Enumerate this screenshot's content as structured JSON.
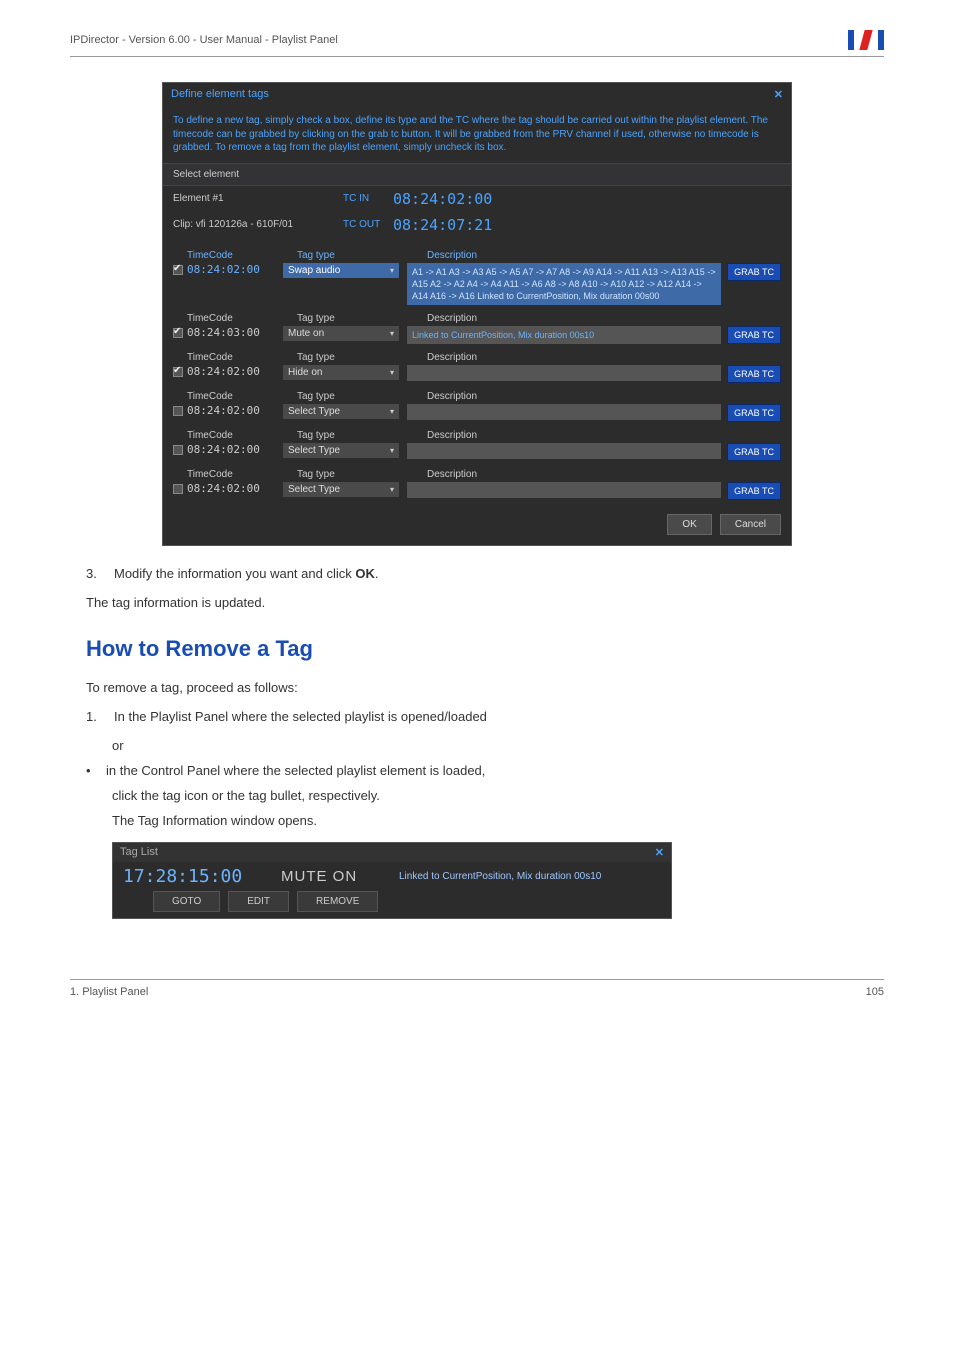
{
  "doc_header": "IPDirector - Version 6.00 - User Manual - Playlist Panel",
  "dialog": {
    "title": "Define element tags",
    "close": "✕",
    "intro": "To define a new tag, simply check a box, define its type and the TC where the tag should be carried out within the playlist element. The timecode can be grabbed by clicking on the grab tc button. It will be grabbed from the PRV channel if used, otherwise no timecode is grabbed. To remove a tag from the playlist element, simply uncheck its box.",
    "select_element": "Select element",
    "element_label": "Element #1",
    "clip_label": "Clip: vfi 120126a - 610F/01",
    "tcin_label": "TC IN",
    "tcout_label": "TC OUT",
    "tcin_val": "08:24:02:00",
    "tcout_val": "08:24:07:21",
    "col_tc": "TimeCode",
    "col_type": "Tag type",
    "col_desc": "Description",
    "grab": "GRAB TC",
    "rows": [
      {
        "checked": true,
        "highlight": true,
        "tc": "08:24:02:00",
        "type": "Swap audio",
        "desc": "A1 -> A1  A3 -> A3  A5 -> A5  A7 -> A7  A8 -> A9  A14 -> A11  A13 -> A13  A15 -> A15  A2 -> A2  A4 -> A4  A11 -> A6  A8 -> A8  A10 -> A10  A12 -> A12  A14 -> A14  A16 -> A16  Linked to CurrentPosition, Mix duration 00s00"
      },
      {
        "checked": true,
        "highlight": false,
        "tc": "08:24:03:00",
        "type": "Mute on",
        "desc": "Linked to CurrentPosition, Mix duration 00s10"
      },
      {
        "checked": true,
        "highlight": false,
        "tc": "08:24:02:00",
        "type": "Hide on",
        "desc": ""
      },
      {
        "checked": false,
        "highlight": false,
        "tc": "08:24:02:00",
        "type": "Select Type",
        "desc": ""
      },
      {
        "checked": false,
        "highlight": false,
        "tc": "08:24:02:00",
        "type": "Select Type",
        "desc": ""
      },
      {
        "checked": false,
        "highlight": false,
        "tc": "08:24:02:00",
        "type": "Select Type",
        "desc": ""
      }
    ],
    "ok": "OK",
    "cancel": "Cancel"
  },
  "step3_num": "3.",
  "step3_text_a": "Modify the information you want and click ",
  "step3_bold": "OK",
  "step3_text_b": ".",
  "updated_text": "The tag information is updated.",
  "section_title": "How to Remove a Tag",
  "remove_intro": "To remove a tag, proceed as follows:",
  "step1_num": "1.",
  "step1_text": "In the Playlist Panel where the selected playlist is opened/loaded",
  "or_text": "or",
  "bullet_dot": "•",
  "bullet_text": "in the Control Panel where the selected playlist element is loaded,",
  "click_text": "click the tag icon or the tag bullet, respectively.",
  "opens_text": "The Tag Information window opens.",
  "taglist": {
    "title": "Tag List",
    "close": "✕",
    "tc": "17:28:15:00",
    "mute": "MUTE ON",
    "desc": "Linked to CurrentPosition, Mix duration 00s10",
    "goto": "GOTO",
    "edit": "EDIT",
    "remove": "REMOVE"
  },
  "footer_left": "1. Playlist Panel",
  "footer_right": "105"
}
